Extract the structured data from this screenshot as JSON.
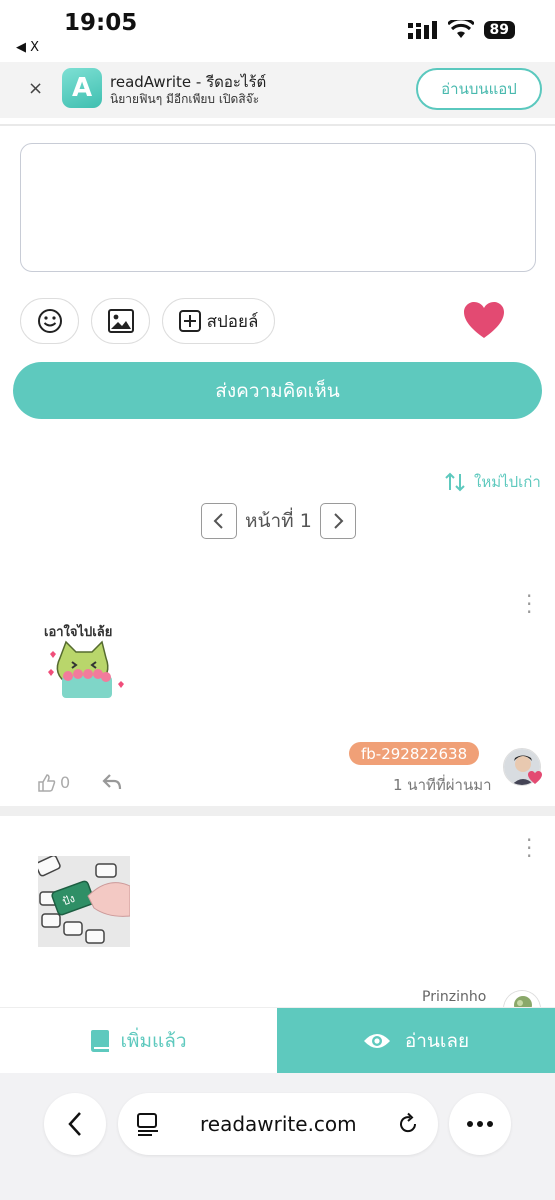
{
  "status_bar": {
    "time": "19:05",
    "back_label": "◀ X",
    "battery": "89"
  },
  "banner": {
    "close": "×",
    "logo_letter": "A",
    "title": "readAwrite - รีดอะไร้ต์",
    "subtitle": "นิยายฟินๆ มีอีกเพียบ เปิดสิจ๊ะ",
    "open_app": "อ่านบนแอป"
  },
  "composer": {
    "spoiler_label": "สปอยล์",
    "send_label": "ส่งความคิดเห็น"
  },
  "sort_label": "ใหม่ไปเก่า",
  "pager": {
    "label": "หน้าที่ 1"
  },
  "comments": [
    {
      "sticker_text": "เอาใจไปเล้ย",
      "likes": "0",
      "user": "fb-292822638",
      "time": "1 นาทีที่ผ่านมา"
    },
    {
      "sticker_text": "ปัง",
      "user": "Prinzinho"
    }
  ],
  "action_bar": {
    "added_label": "เพิ่มแล้ว",
    "read_label": "อ่านเลย"
  },
  "browser": {
    "url": "readawrite.com"
  },
  "colors": {
    "accent": "#5ec9be",
    "heart": "#e34a72",
    "user_tag": "#f0a077"
  },
  "icons": [
    "emoji-icon",
    "image-icon",
    "plus-box-icon",
    "heart-icon",
    "sort-icon",
    "chevron-left-icon",
    "chevron-right-icon",
    "more-icon",
    "like-icon",
    "reply-icon",
    "book-icon",
    "eye-icon",
    "reader-icon",
    "reload-icon"
  ]
}
